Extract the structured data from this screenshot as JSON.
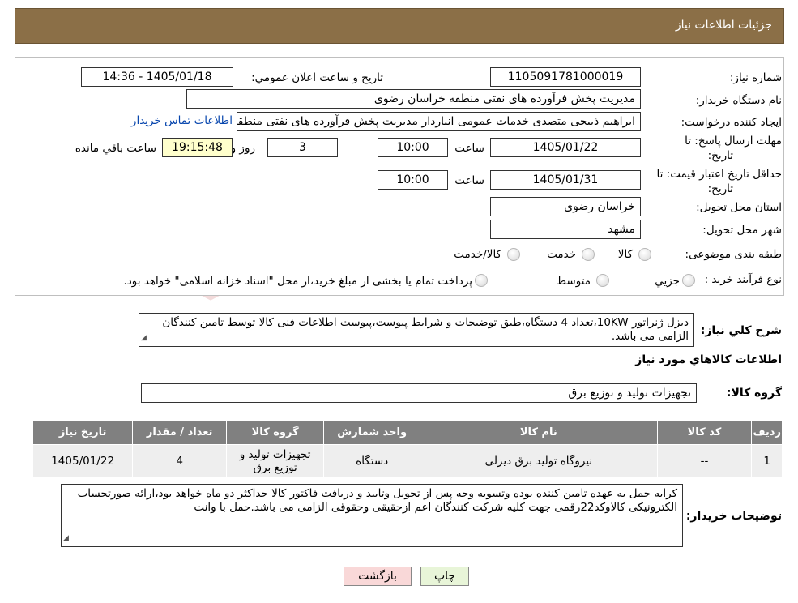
{
  "header": {
    "title": "جزئیات اطلاعات نیاز"
  },
  "form": {
    "need_number_label": "شماره نیاز:",
    "need_number": "1105091781000019",
    "announce_label": "تاریخ و ساعت اعلان عمومي:",
    "announce_value": "1405/01/18 - 14:36",
    "buyer_org_label": "نام دستگاه خریدار:",
    "buyer_org": "مدیریت پخش فرآورده های نفتی منطقه خراسان رضوی",
    "requester_label": "ایجاد کننده درخواست:",
    "requester": "ابراهیم ذبیحی متصدی خدمات عمومی انباردار مدیریت پخش فرآورده های نفتی منطقه خراسان رضوی",
    "contact_link": "اطلاعات تماس خریدار",
    "deadline_label_1": "مهلت ارسال پاسخ: تا",
    "deadline_label_2": "تاریخ:",
    "deadline_date": "1405/01/22",
    "time_label": "ساعت",
    "deadline_time": "10:00",
    "days_value": "3",
    "days_label": "روز و",
    "remaining_time": "19:15:48",
    "remaining_label": "ساعت باقي مانده",
    "validity_label_1": "حداقل تاریخ اعتبار قیمت: تا",
    "validity_label_2": "تاریخ:",
    "validity_date": "1405/01/31",
    "validity_time": "10:00",
    "province_label": "استان محل تحویل:",
    "province": "خراسان رضوی",
    "city_label": "شهر محل تحویل:",
    "city": "مشهد",
    "category_label": "طبقه بندی موضوعی:",
    "category_options": [
      "کالا",
      "خدمت",
      "کالا/خدمت"
    ],
    "process_label": "نوع فرآیند خرید :",
    "process_options": [
      "جزیي",
      "متوسط"
    ],
    "process_note": "پرداخت تمام یا بخشی از مبلغ خرید،از محل \"اسناد خزانه اسلامی\" خواهد بود."
  },
  "description": {
    "label": "شرح کلي نیاز:",
    "text": "دیزل ژنراتور 10KW،تعداد 4 دستگاه،طبق توضیحات و شرایط پیوست،پیوست اطلاعات فنی کالا توسط تامین کنندگان الزامی می باشد."
  },
  "goods": {
    "section_title": "اطلاعات کالاهاي مورد نیاز",
    "group_label": "گروه کالا:",
    "group_value": "تجهیزات تولید و توزیع برق",
    "columns": [
      "ردیف",
      "کد کالا",
      "نام کالا",
      "واحد شمارش",
      "گروه کالا",
      "تعداد / مقدار",
      "تاریخ نیاز"
    ],
    "rows": [
      [
        "1",
        "--",
        "نیروگاه تولید برق دیزلی",
        "دستگاه",
        "تجهیزات تولید و توزیع برق",
        "4",
        "1405/01/22"
      ]
    ]
  },
  "buyer_notes": {
    "label": "توضیحات خریدار:",
    "text": "کرایه حمل به عهده تامین کننده بوده وتسویه وجه پس از تحویل وتایید و دریافت فاکتور کالا حداکثر دو ماه خواهد بود،ارائه صورتحساب الکترونیکی کالاوکد22رقمی جهت کلیه شرکت کنندگان اعم ازحقیقی وحقوقی الزامی می باشد.حمل با وانت"
  },
  "buttons": {
    "print": "چاپ",
    "back": "بازگشت"
  },
  "colors": {
    "header_bg": "#8b6f47",
    "table_header": "#808080",
    "remaining_bg": "#ffffcc"
  }
}
